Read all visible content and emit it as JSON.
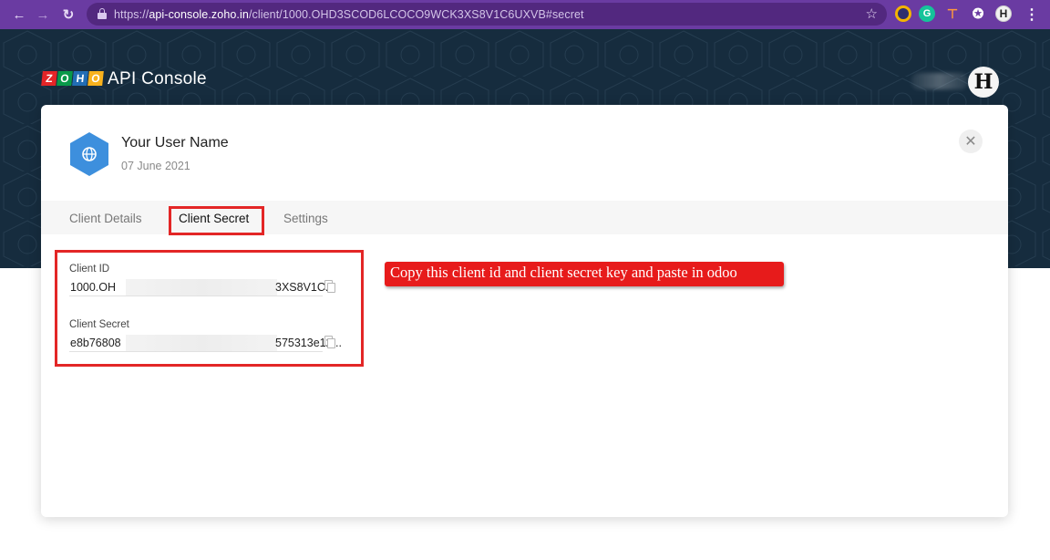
{
  "browser": {
    "url_prefix": "https://",
    "url_host": "api-console.zoho.in",
    "url_path": "/client/1000.OHD3SCOD6LCOCO9WCK3XS8V1C6UXVB#secret"
  },
  "header": {
    "logo_letters": [
      "Z",
      "O",
      "H",
      "O"
    ],
    "app_title": "API Console",
    "avatar_letter": "H"
  },
  "client": {
    "name": "Your User Name",
    "date": "07 June 2021"
  },
  "tabs": [
    {
      "label": "Client Details",
      "active": false
    },
    {
      "label": "Client Secret",
      "active": true
    },
    {
      "label": "Settings",
      "active": false
    }
  ],
  "fields": {
    "client_id": {
      "label": "Client ID",
      "value_start": "1000.OH",
      "value_end": "3XS8V1C..."
    },
    "client_secret": {
      "label": "Client Secret",
      "value_start": "e8b76808",
      "value_end": "575313e12..."
    }
  },
  "annotation": {
    "text": "Copy this client id and client secret key and paste in odoo"
  },
  "colors": {
    "browser_bar": "#6a3ba2",
    "header_band": "#162c3e",
    "highlight_red": "#e32626",
    "note_red": "#e71b1b"
  }
}
